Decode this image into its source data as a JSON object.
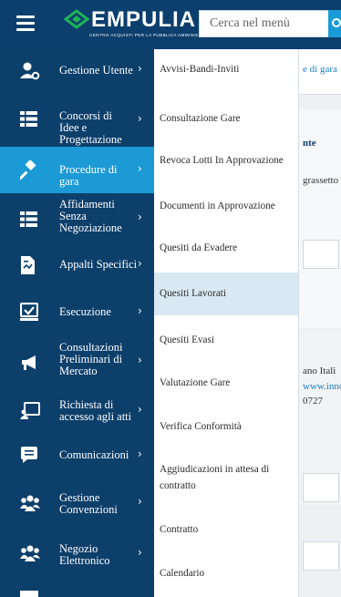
{
  "header": {
    "logo_text": "EMPULIA",
    "logo_subtitle": "CENTRO ACQUISTI PER LA PUBBLICA AMMINISTRAZIONE",
    "search_placeholder": "Cerca nel menù",
    "background_color": "#0c3f6d",
    "accent_color": "#1a9bd7"
  },
  "sidebar": {
    "active_color": "#1b9ad6",
    "items": [
      {
        "label": "Gestione Utente",
        "icon": "user-gear-icon",
        "active": false
      },
      {
        "label": "Concorsi di Idee e Progettazione",
        "icon": "list-icon",
        "active": false
      },
      {
        "label": "Procedure di gara",
        "icon": "gavel-icon",
        "active": true
      },
      {
        "label": "Affidamenti Senza Negoziazione",
        "icon": "list-icon",
        "active": false
      },
      {
        "label": "Appalti Specifici",
        "icon": "document-chart-icon",
        "active": false
      },
      {
        "label": "Esecuzione",
        "icon": "check-box-icon",
        "active": false
      },
      {
        "label": "Consultazioni Preliminari di Mercato",
        "icon": "megaphone-icon",
        "active": false
      },
      {
        "label": "Richiesta di accesso agli atti",
        "icon": "presentation-icon",
        "active": false
      },
      {
        "label": "Comunicazioni",
        "icon": "message-icon",
        "active": false
      },
      {
        "label": "Gestione Convenzioni",
        "icon": "group-icon",
        "active": false
      },
      {
        "label": "Negozio Elettronico",
        "icon": "group-icon",
        "active": false
      }
    ]
  },
  "submenu": {
    "items": [
      {
        "label": "Avvisi-Bandi-Inviti",
        "active": false
      },
      {
        "label": "Consultazione Gare",
        "active": false
      },
      {
        "label": "Revoca Lotti In Approvazione",
        "active": false
      },
      {
        "label": "Documenti in Approvazione",
        "active": false
      },
      {
        "label": "Quesiti da Evadere",
        "active": false
      },
      {
        "label": "Quesiti Lavorati",
        "active": true
      },
      {
        "label": "Quesiti Evasi",
        "active": false
      },
      {
        "label": "Valutazione Gare",
        "active": false
      },
      {
        "label": "Verifica Conformità",
        "active": false
      },
      {
        "label": "Aggiudicazioni in attesa di contratto",
        "active": false
      },
      {
        "label": "Contratto",
        "active": false
      },
      {
        "label": "Calendario",
        "active": false
      }
    ]
  },
  "background": {
    "texts": [
      "e di gara",
      "nte",
      "grassetto",
      "ano Itali",
      "www.inno",
      "0727"
    ]
  }
}
